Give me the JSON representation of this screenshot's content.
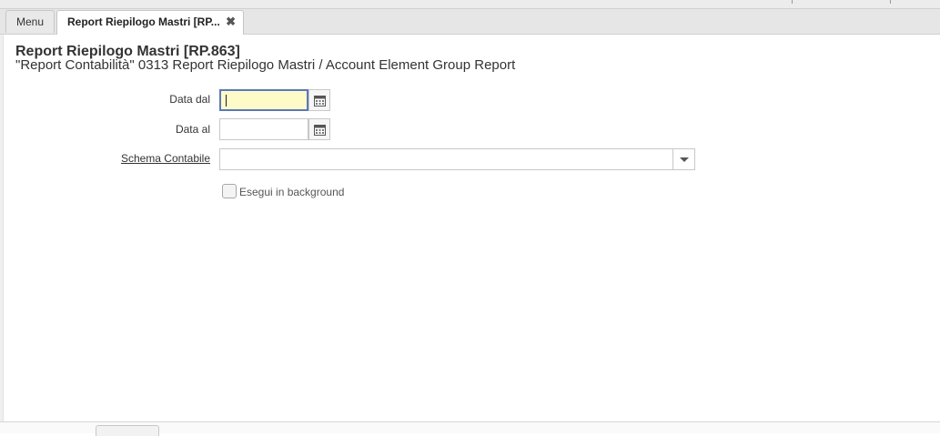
{
  "tabs": {
    "menu_label": "Menu",
    "report_label": "Report Riepilogo Mastri [RP...",
    "close_glyph": "✖"
  },
  "header": {
    "title": "Report Riepilogo Mastri [RP.863]",
    "subtitle": "\"Report Contabilità\" 0313 Report Riepilogo Mastri / Account Element Group Report"
  },
  "form": {
    "date_from_label": "Data dal",
    "date_from_value": "",
    "date_to_label": "Data al",
    "date_to_value": "",
    "schema_label": "Schema Contabile",
    "schema_value": "",
    "background_label": "Esegui in background",
    "background_checked": false
  },
  "colors": {
    "focus_field_bg": "#fffbc8",
    "focus_border": "#5b79b8"
  }
}
